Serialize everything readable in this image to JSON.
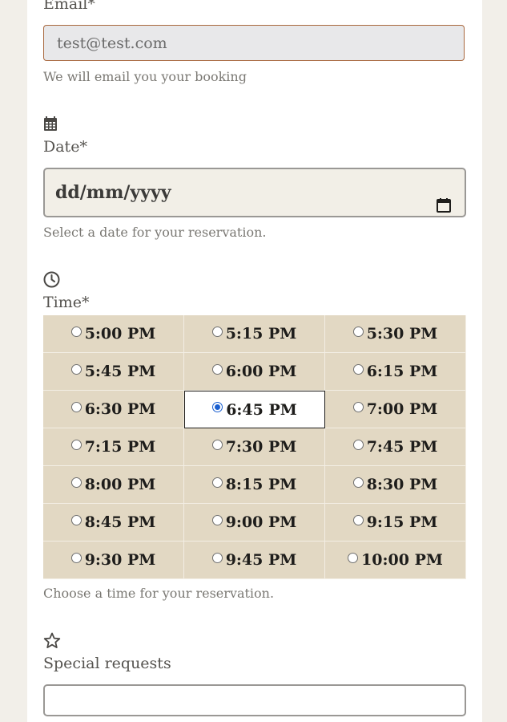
{
  "email": {
    "label": "Email*",
    "value": "test@test.com",
    "help": "We will email you your booking"
  },
  "date": {
    "icon": "calendar-icon",
    "label": "Date*",
    "placeholder": "dd/mm/yyyy",
    "help": "Select a date for your reservation."
  },
  "time": {
    "icon": "clock-icon",
    "label": "Time*",
    "selected": "6:45 PM",
    "slots": [
      "5:00 PM",
      "5:15 PM",
      "5:30 PM",
      "5:45 PM",
      "6:00 PM",
      "6:15 PM",
      "6:30 PM",
      "6:45 PM",
      "7:00 PM",
      "7:15 PM",
      "7:30 PM",
      "7:45 PM",
      "8:00 PM",
      "8:15 PM",
      "8:30 PM",
      "8:45 PM",
      "9:00 PM",
      "9:15 PM",
      "9:30 PM",
      "9:45 PM",
      "10:00 PM"
    ],
    "help": "Choose a time for your reservation."
  },
  "special": {
    "icon": "star-icon",
    "label": "Special requests"
  },
  "colors": {
    "page_background": "#f2efe9",
    "slot_background": "#e2d8c3",
    "radio_accent": "#1a5fd0",
    "email_border": "#a9683e"
  }
}
